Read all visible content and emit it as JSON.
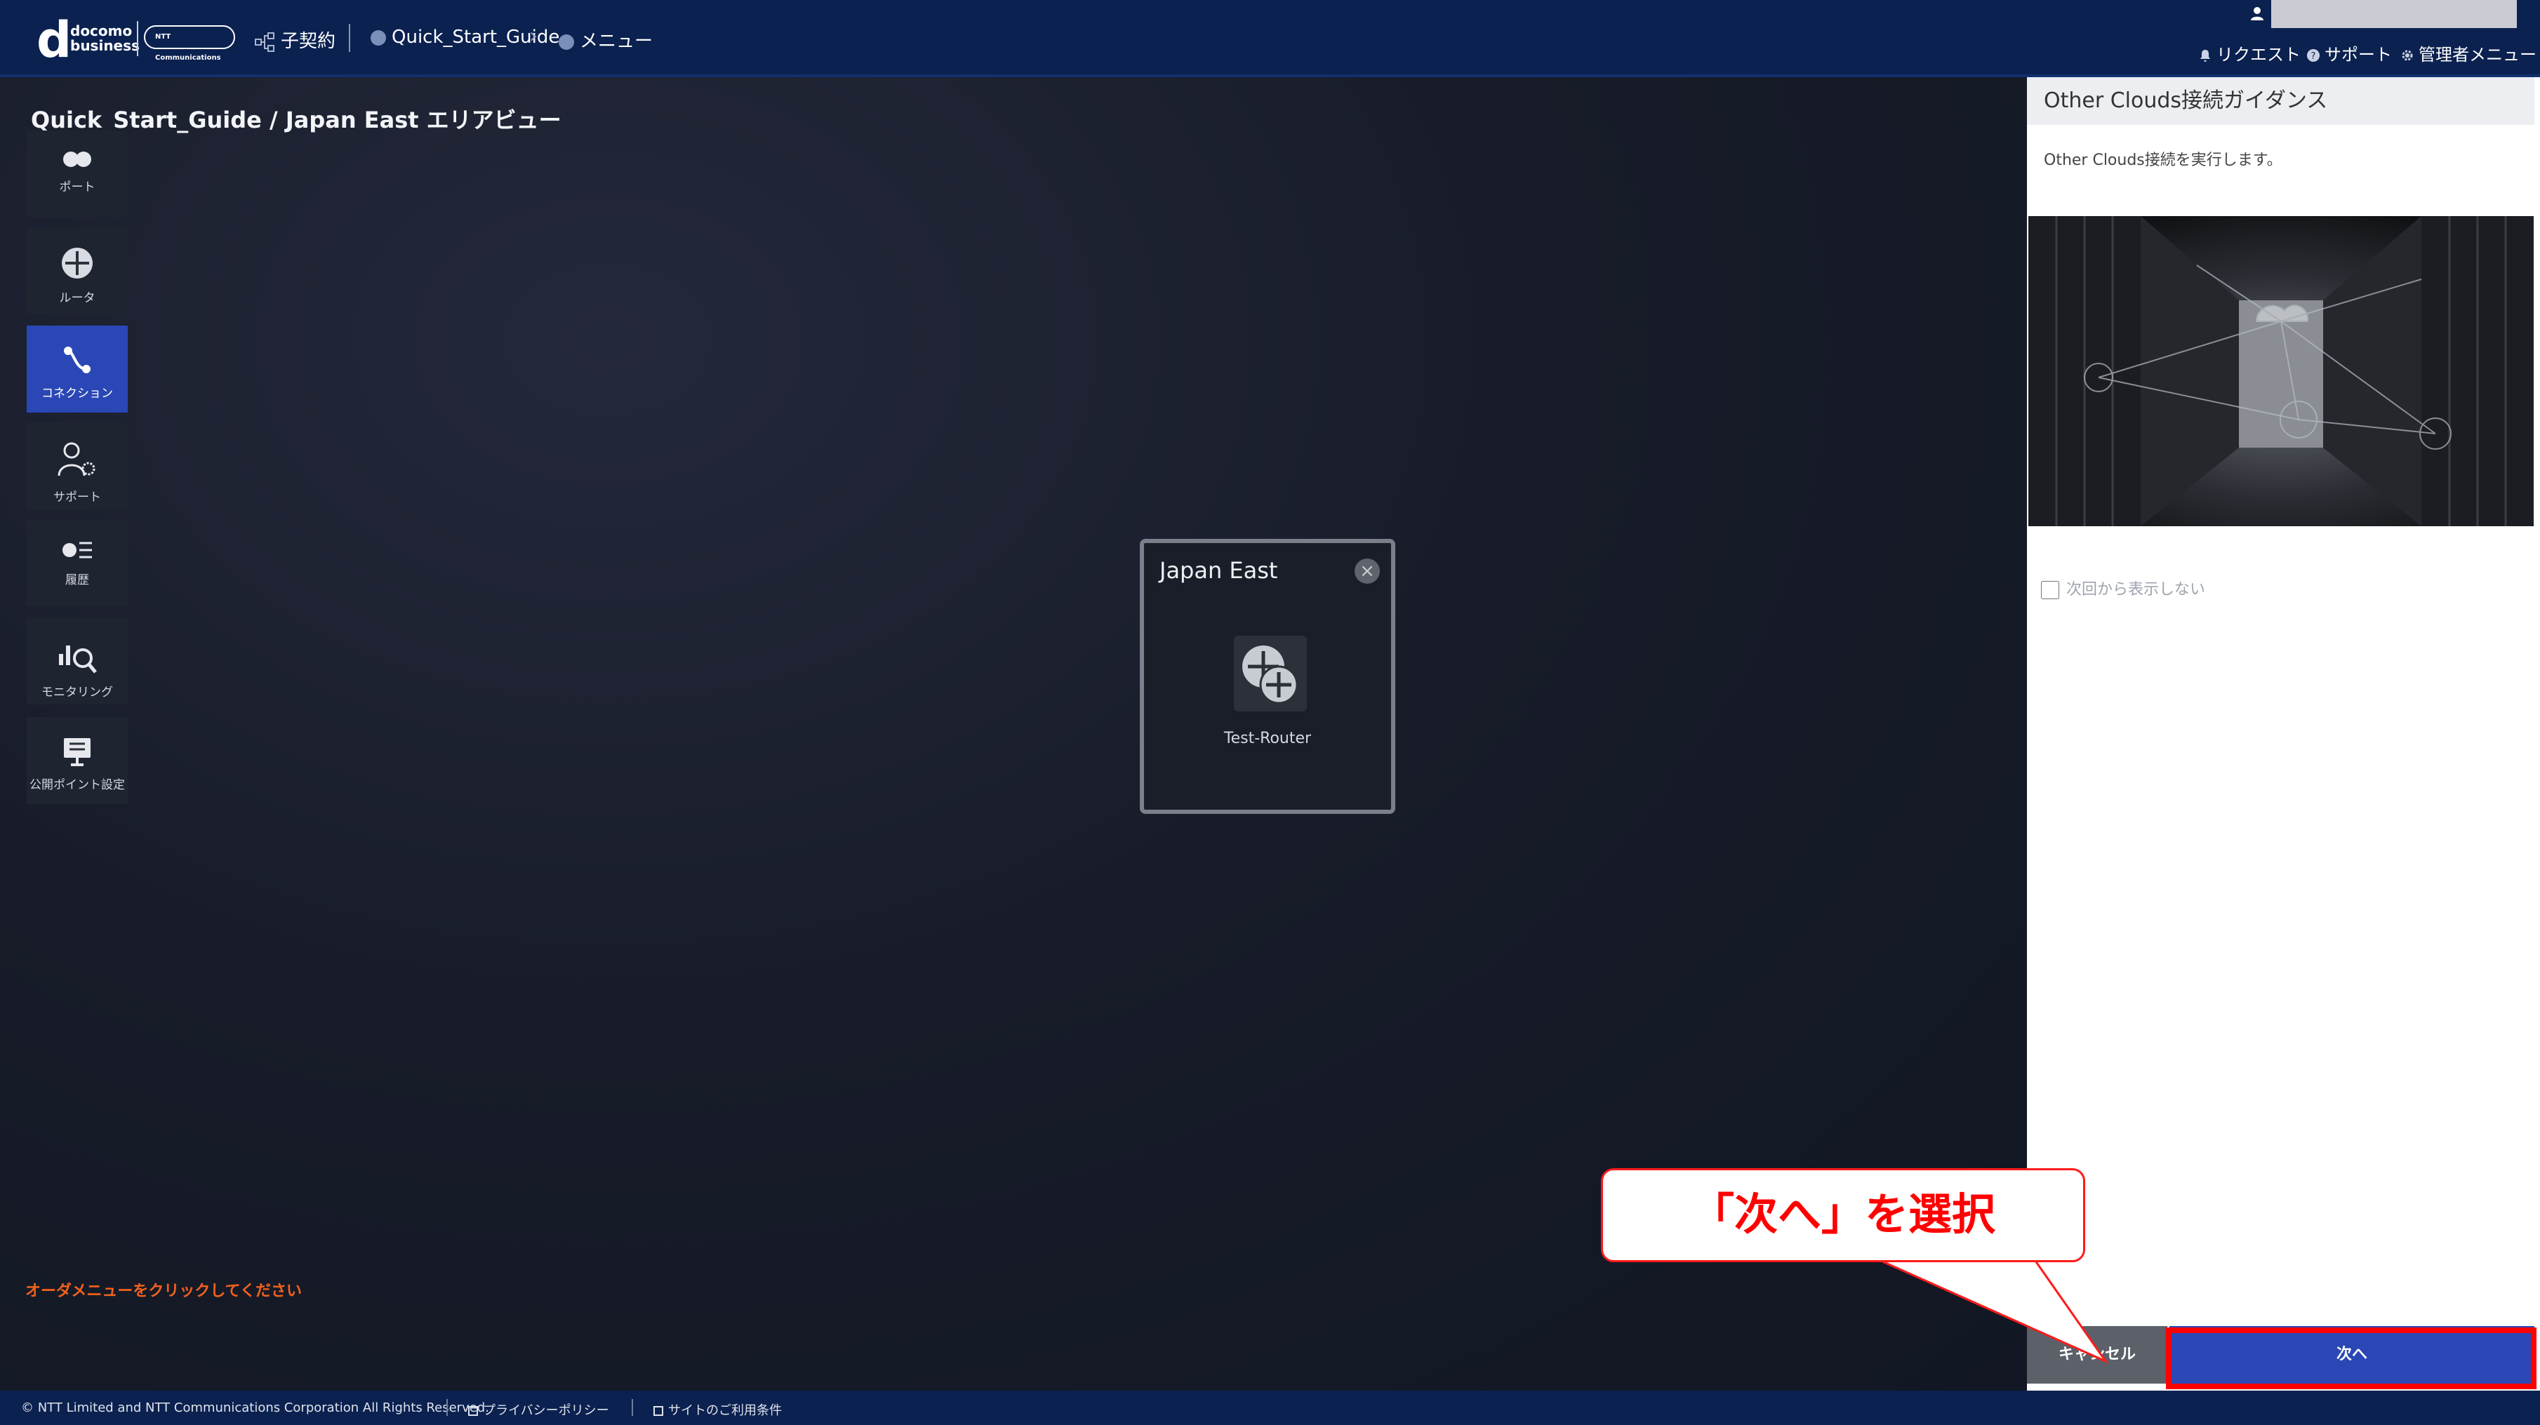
{
  "header": {
    "logo_d": "d",
    "logo_line1": "docomo",
    "logo_line2": "business",
    "ntt_logo": "NTT Communications",
    "crumb_contract": "子契約",
    "crumb_guide": "Quick_Start_Guide",
    "crumb_menu": "メニュー",
    "link_request": "リクエスト",
    "link_support": "サポート",
    "link_admin": "管理者メニュー"
  },
  "main": {
    "title": "Quick_Start_Guide / Japan East エリアビュー",
    "order_hint": "オーダメニューをクリックしてください"
  },
  "sidebar": {
    "items": [
      {
        "label": "ポート",
        "icon": "port-icon"
      },
      {
        "label": "ルータ",
        "icon": "router-icon"
      },
      {
        "label": "コネクション",
        "icon": "connection-icon"
      },
      {
        "label": "サポート",
        "icon": "support-icon"
      },
      {
        "label": "履歴",
        "icon": "history-icon"
      },
      {
        "label": "モニタリング",
        "icon": "monitoring-icon"
      },
      {
        "label": "公開ポイント設定",
        "icon": "public-point-icon"
      }
    ],
    "active_index": 2
  },
  "area_card": {
    "title": "Japan East",
    "router_label": "Test-Router"
  },
  "panel": {
    "title": "Other Clouds接続ガイダンス",
    "text": "Other Clouds接続を実行します。",
    "checkbox_label": "次回から表示しない",
    "cancel_label": "キャンセル",
    "next_label": "次へ"
  },
  "footer": {
    "copyright": "© NTT Limited and NTT Communications Corporation All Rights Reserved.",
    "privacy": "プライバシーポリシー",
    "terms": "サイトのご利用条件"
  },
  "annotation": {
    "callout_text": "「次へ」を選択"
  },
  "colors": {
    "header_bg": "#0b2150",
    "accent_blue": "#2a47b5",
    "highlight_red": "#ff0000",
    "hint_orange": "#f2621c"
  }
}
